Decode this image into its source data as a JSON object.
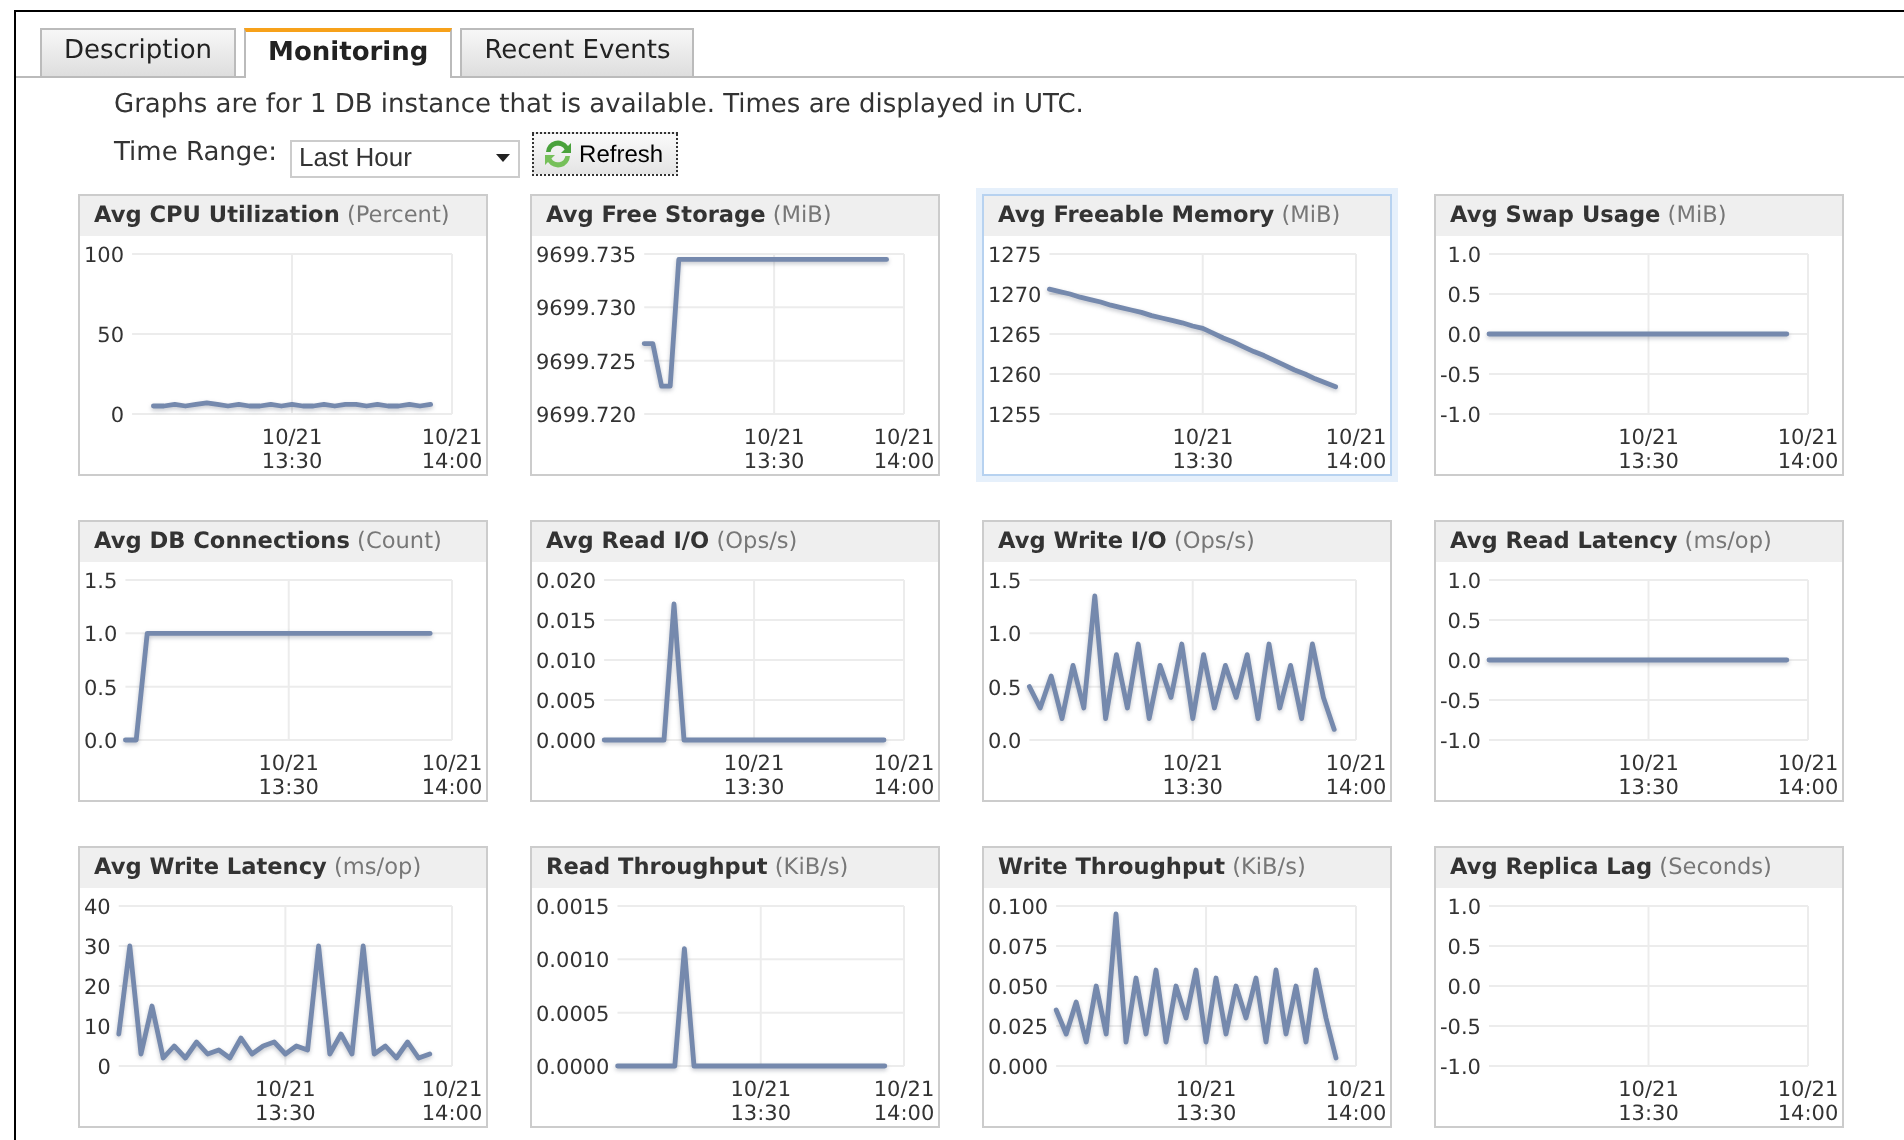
{
  "tabs": [
    {
      "label": "Description",
      "selected": false
    },
    {
      "label": "Monitoring",
      "selected": true
    },
    {
      "label": "Recent Events",
      "selected": false
    }
  ],
  "info_text": "Graphs are for 1 DB instance that is available. Times are displayed in UTC.",
  "time_range": {
    "label": "Time Range:",
    "value": "Last Hour"
  },
  "refresh_button": {
    "label": "Refresh"
  },
  "graphs": [
    {
      "title": "Avg CPU Utilization",
      "unit": "(Percent)",
      "selected": false,
      "chart_data": {
        "type": "line",
        "grid": true,
        "categories": [
          null,
          null,
          null,
          null,
          null,
          null,
          null,
          null,
          null,
          null,
          null,
          null,
          null,
          null,
          null,
          "10/21 13:30",
          null,
          null,
          null,
          null,
          null,
          null,
          null,
          null,
          null,
          null,
          null,
          null,
          null,
          null,
          "10/21 14:00"
        ],
        "values": [
          null,
          null,
          5,
          5,
          6,
          5,
          6,
          7,
          6,
          5,
          6,
          5,
          5,
          6,
          5,
          6,
          5,
          5,
          6,
          5,
          6,
          6,
          5,
          6,
          5,
          5,
          6,
          5,
          6,
          null,
          null
        ],
        "ylim": [
          0,
          100
        ],
        "yticks": [
          0,
          50,
          100
        ]
      }
    },
    {
      "title": "Avg Free Storage",
      "unit": "(MiB)",
      "selected": false,
      "chart_data": {
        "type": "line",
        "grid": true,
        "categories": [
          null,
          null,
          null,
          null,
          null,
          null,
          null,
          null,
          null,
          null,
          null,
          null,
          null,
          null,
          null,
          "10/21 13:30",
          null,
          null,
          null,
          null,
          null,
          null,
          null,
          null,
          null,
          null,
          null,
          null,
          null,
          null,
          "10/21 14:00"
        ],
        "values": [
          9699.7266,
          9699.7266,
          9699.7226,
          9699.7226,
          9699.7345,
          9699.7345,
          9699.7345,
          9699.7345,
          9699.7345,
          9699.7345,
          9699.7345,
          9699.7345,
          9699.7345,
          9699.7345,
          9699.7345,
          9699.7345,
          9699.7345,
          9699.7345,
          9699.7345,
          9699.7345,
          9699.7345,
          9699.7345,
          9699.7345,
          9699.7345,
          9699.7345,
          9699.7345,
          9699.7345,
          9699.7345,
          9699.7345,
          null,
          null
        ],
        "ylim": [
          9699.72,
          9699.735
        ],
        "yticks": [
          {
            "value": 9699.72,
            "label": "9699.720"
          },
          {
            "value": 9699.725,
            "label": "9699.725"
          },
          {
            "value": 9699.73,
            "label": "9699.730"
          },
          {
            "value": 9699.735,
            "label": "9699.735"
          }
        ]
      }
    },
    {
      "title": "Avg Freeable Memory",
      "unit": "(MiB)",
      "selected": true,
      "chart_data": {
        "type": "line",
        "grid": true,
        "categories": [
          null,
          null,
          null,
          null,
          null,
          null,
          null,
          null,
          null,
          null,
          null,
          null,
          null,
          null,
          null,
          "10/21 13:30",
          null,
          null,
          null,
          null,
          null,
          null,
          null,
          null,
          null,
          null,
          null,
          null,
          null,
          null,
          "10/21 14:00"
        ],
        "values": [
          1270.6,
          1270.3,
          1270.0,
          1269.6,
          1269.3,
          1269.0,
          1268.6,
          1268.3,
          1268.0,
          1267.7,
          1267.3,
          1267.0,
          1266.7,
          1266.4,
          1266.0,
          1265.7,
          1265.1,
          1264.5,
          1264.0,
          1263.4,
          1262.8,
          1262.3,
          1261.7,
          1261.1,
          1260.5,
          1260.0,
          1259.4,
          1258.9,
          1258.4,
          null,
          null
        ],
        "ylim": [
          1255,
          1275
        ],
        "yticks": [
          1255,
          1260,
          1265,
          1270,
          1275
        ]
      }
    },
    {
      "title": "Avg Swap Usage",
      "unit": "(MiB)",
      "selected": false,
      "chart_data": {
        "type": "line",
        "grid": true,
        "categories": [
          null,
          null,
          null,
          null,
          null,
          null,
          null,
          null,
          null,
          null,
          null,
          null,
          null,
          null,
          null,
          "10/21 13:30",
          null,
          null,
          null,
          null,
          null,
          null,
          null,
          null,
          null,
          null,
          null,
          null,
          null,
          null,
          "10/21 14:00"
        ],
        "values": [
          0,
          0,
          0,
          0,
          0,
          0,
          0,
          0,
          0,
          0,
          0,
          0,
          0,
          0,
          0,
          0,
          0,
          0,
          0,
          0,
          0,
          0,
          0,
          0,
          0,
          0,
          0,
          0,
          0,
          null,
          null
        ],
        "ylim": [
          -1,
          1
        ],
        "yticks": [
          {
            "value": -1,
            "label": "-1.0"
          },
          {
            "value": -0.5,
            "label": "-0.5"
          },
          {
            "value": 0,
            "label": "0.0"
          },
          {
            "value": 0.5,
            "label": "0.5"
          },
          {
            "value": 1,
            "label": "1.0"
          }
        ]
      }
    },
    {
      "title": "Avg DB Connections",
      "unit": "(Count)",
      "selected": false,
      "chart_data": {
        "type": "line",
        "grid": true,
        "categories": [
          null,
          null,
          null,
          null,
          null,
          null,
          null,
          null,
          null,
          null,
          null,
          null,
          null,
          null,
          null,
          "10/21 13:30",
          null,
          null,
          null,
          null,
          null,
          null,
          null,
          null,
          null,
          null,
          null,
          null,
          null,
          null,
          "10/21 14:00"
        ],
        "values": [
          0,
          0,
          1,
          1,
          1,
          1,
          1,
          1,
          1,
          1,
          1,
          1,
          1,
          1,
          1,
          1,
          1,
          1,
          1,
          1,
          1,
          1,
          1,
          1,
          1,
          1,
          1,
          1,
          1,
          null,
          null
        ],
        "ylim": [
          0,
          1.5
        ],
        "yticks": [
          {
            "value": 0,
            "label": "0.0"
          },
          {
            "value": 0.5,
            "label": "0.5"
          },
          {
            "value": 1,
            "label": "1.0"
          },
          {
            "value": 1.5,
            "label": "1.5"
          }
        ]
      }
    },
    {
      "title": "Avg Read I/O",
      "unit": "(Ops/s)",
      "selected": false,
      "chart_data": {
        "type": "line",
        "grid": true,
        "categories": [
          null,
          null,
          null,
          null,
          null,
          null,
          null,
          null,
          null,
          null,
          null,
          null,
          null,
          null,
          null,
          "10/21 13:30",
          null,
          null,
          null,
          null,
          null,
          null,
          null,
          null,
          null,
          null,
          null,
          null,
          null,
          null,
          "10/21 14:00"
        ],
        "values": [
          0,
          0,
          0,
          0,
          0,
          0,
          0,
          0.017,
          0,
          0,
          0,
          0,
          0,
          0,
          0,
          0,
          0,
          0,
          0,
          0,
          0,
          0,
          0,
          0,
          0,
          0,
          0,
          0,
          0,
          null,
          null
        ],
        "ylim": [
          0,
          0.02
        ],
        "yticks": [
          {
            "value": 0,
            "label": "0.000"
          },
          {
            "value": 0.005,
            "label": "0.005"
          },
          {
            "value": 0.01,
            "label": "0.010"
          },
          {
            "value": 0.015,
            "label": "0.015"
          },
          {
            "value": 0.02,
            "label": "0.020"
          }
        ]
      }
    },
    {
      "title": "Avg Write I/O",
      "unit": "(Ops/s)",
      "selected": false,
      "chart_data": {
        "type": "line",
        "grid": true,
        "categories": [
          null,
          null,
          null,
          null,
          null,
          null,
          null,
          null,
          null,
          null,
          null,
          null,
          null,
          null,
          null,
          "10/21 13:30",
          null,
          null,
          null,
          null,
          null,
          null,
          null,
          null,
          null,
          null,
          null,
          null,
          null,
          null,
          "10/21 14:00"
        ],
        "values": [
          0.5,
          0.3,
          0.6,
          0.2,
          0.7,
          0.3,
          1.35,
          0.2,
          0.8,
          0.3,
          0.9,
          0.2,
          0.7,
          0.4,
          0.9,
          0.2,
          0.8,
          0.3,
          0.7,
          0.4,
          0.8,
          0.2,
          0.9,
          0.3,
          0.7,
          0.2,
          0.9,
          0.4,
          0.1,
          null,
          null
        ],
        "ylim": [
          0,
          1.5
        ],
        "yticks": [
          {
            "value": 0,
            "label": "0.0"
          },
          {
            "value": 0.5,
            "label": "0.5"
          },
          {
            "value": 1,
            "label": "1.0"
          },
          {
            "value": 1.5,
            "label": "1.5"
          }
        ]
      }
    },
    {
      "title": "Avg Read Latency",
      "unit": "(ms/op)",
      "selected": false,
      "chart_data": {
        "type": "line",
        "grid": true,
        "categories": [
          null,
          null,
          null,
          null,
          null,
          null,
          null,
          null,
          null,
          null,
          null,
          null,
          null,
          null,
          null,
          "10/21 13:30",
          null,
          null,
          null,
          null,
          null,
          null,
          null,
          null,
          null,
          null,
          null,
          null,
          null,
          null,
          "10/21 14:00"
        ],
        "values": [
          0,
          0,
          0,
          0,
          0,
          0,
          0,
          0,
          0,
          0,
          0,
          0,
          0,
          0,
          0,
          0,
          0,
          0,
          0,
          0,
          0,
          0,
          0,
          0,
          0,
          0,
          0,
          0,
          0,
          null,
          null
        ],
        "ylim": [
          -1,
          1
        ],
        "yticks": [
          {
            "value": -1,
            "label": "-1.0"
          },
          {
            "value": -0.5,
            "label": "-0.5"
          },
          {
            "value": 0,
            "label": "0.0"
          },
          {
            "value": 0.5,
            "label": "0.5"
          },
          {
            "value": 1,
            "label": "1.0"
          }
        ]
      }
    },
    {
      "title": "Avg Write Latency",
      "unit": "(ms/op)",
      "selected": false,
      "chart_data": {
        "type": "line",
        "grid": true,
        "categories": [
          null,
          null,
          null,
          null,
          null,
          null,
          null,
          null,
          null,
          null,
          null,
          null,
          null,
          null,
          null,
          "10/21 13:30",
          null,
          null,
          null,
          null,
          null,
          null,
          null,
          null,
          null,
          null,
          null,
          null,
          null,
          null,
          "10/21 14:00"
        ],
        "values": [
          8,
          30,
          3,
          15,
          2,
          5,
          2,
          6,
          3,
          4,
          2,
          7,
          3,
          5,
          6,
          3,
          5,
          4,
          30,
          3,
          8,
          3,
          30,
          3,
          5,
          2,
          6,
          2,
          3,
          null,
          null
        ],
        "ylim": [
          0,
          40
        ],
        "yticks": [
          0,
          10,
          20,
          30,
          40
        ]
      }
    },
    {
      "title": "Read Throughput",
      "unit": "(KiB/s)",
      "selected": false,
      "chart_data": {
        "type": "line",
        "grid": true,
        "categories": [
          null,
          null,
          null,
          null,
          null,
          null,
          null,
          null,
          null,
          null,
          null,
          null,
          null,
          null,
          null,
          "10/21 13:30",
          null,
          null,
          null,
          null,
          null,
          null,
          null,
          null,
          null,
          null,
          null,
          null,
          null,
          null,
          "10/21 14:00"
        ],
        "values": [
          0,
          0,
          0,
          0,
          0,
          0,
          0,
          0.0011,
          0,
          0,
          0,
          0,
          0,
          0,
          0,
          0,
          0,
          0,
          0,
          0,
          0,
          0,
          0,
          0,
          0,
          0,
          0,
          0,
          0,
          null,
          null
        ],
        "ylim": [
          0,
          0.0015
        ],
        "yticks": [
          {
            "value": 0,
            "label": "0.0000"
          },
          {
            "value": 0.0005,
            "label": "0.0005"
          },
          {
            "value": 0.001,
            "label": "0.0010"
          },
          {
            "value": 0.0015,
            "label": "0.0015"
          }
        ]
      }
    },
    {
      "title": "Write Throughput",
      "unit": "(KiB/s)",
      "selected": false,
      "chart_data": {
        "type": "line",
        "grid": true,
        "categories": [
          null,
          null,
          null,
          null,
          null,
          null,
          null,
          null,
          null,
          null,
          null,
          null,
          null,
          null,
          null,
          "10/21 13:30",
          null,
          null,
          null,
          null,
          null,
          null,
          null,
          null,
          null,
          null,
          null,
          null,
          null,
          null,
          "10/21 14:00"
        ],
        "values": [
          0.035,
          0.02,
          0.04,
          0.015,
          0.05,
          0.02,
          0.095,
          0.015,
          0.055,
          0.02,
          0.06,
          0.015,
          0.05,
          0.03,
          0.06,
          0.015,
          0.055,
          0.02,
          0.05,
          0.03,
          0.055,
          0.015,
          0.06,
          0.02,
          0.05,
          0.015,
          0.06,
          0.03,
          0.005,
          null,
          null
        ],
        "ylim": [
          0,
          0.1
        ],
        "yticks": [
          {
            "value": 0,
            "label": "0.000"
          },
          {
            "value": 0.025,
            "label": "0.025"
          },
          {
            "value": 0.05,
            "label": "0.050"
          },
          {
            "value": 0.075,
            "label": "0.075"
          },
          {
            "value": 0.1,
            "label": "0.100"
          }
        ]
      }
    },
    {
      "title": "Avg Replica Lag",
      "unit": "(Seconds)",
      "selected": false,
      "chart_data": {
        "type": "line",
        "grid": true,
        "categories": [
          null,
          null,
          null,
          null,
          null,
          null,
          null,
          null,
          null,
          null,
          null,
          null,
          null,
          null,
          null,
          "10/21 13:30",
          null,
          null,
          null,
          null,
          null,
          null,
          null,
          null,
          null,
          null,
          null,
          null,
          null,
          null,
          "10/21 14:00"
        ],
        "ylim": [
          -1,
          1
        ],
        "yticks": [
          {
            "value": -1,
            "label": "-1.0"
          },
          {
            "value": -0.5,
            "label": "-0.5"
          },
          {
            "value": 0,
            "label": "0.0"
          },
          {
            "value": 0.5,
            "label": "0.5"
          },
          {
            "value": 1,
            "label": "1.0"
          }
        ]
      }
    }
  ]
}
